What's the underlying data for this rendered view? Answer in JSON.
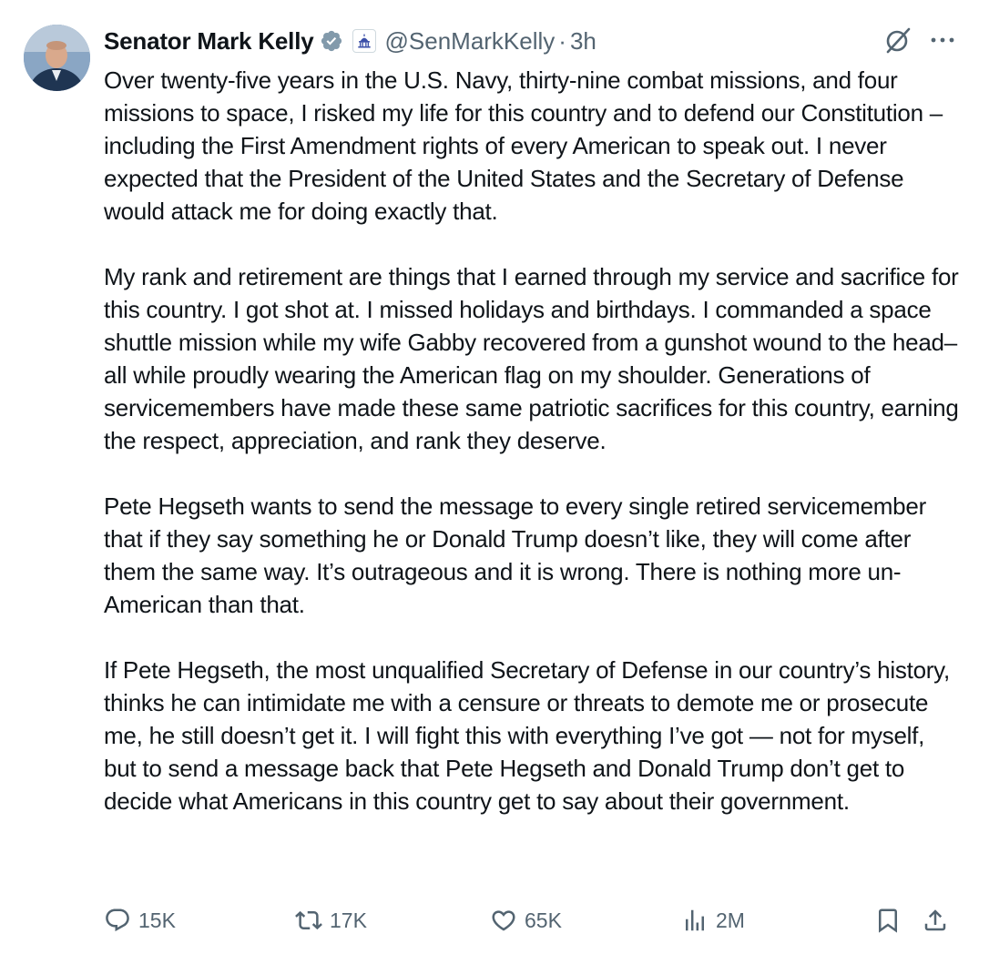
{
  "author": {
    "name": "Senator Mark Kelly",
    "handle": "@SenMarkKelly",
    "separator": "·",
    "time": "3h"
  },
  "icons": {
    "verified": "verified-badge-icon",
    "affiliation": "capitol-building-icon",
    "grok": "grok-icon",
    "more": "more-options-icon"
  },
  "paragraphs": [
    "Over twenty-five years in the U.S. Navy, thirty-nine combat missions, and four missions to space, I risked my life for this country and to defend our Constitution – including the First Amendment rights of every American to speak out. I never expected that the President of the United States and the Secretary of Defense would attack me for doing exactly that.",
    "My rank and retirement are things that I earned through my service and sacrifice for this country. I got shot at. I missed holidays and birthdays. I commanded a space shuttle mission while my wife Gabby recovered from a gunshot wound to the head– all while proudly wearing the American flag on my shoulder. Generations of servicemembers have made these same patriotic sacrifices for this country, earning the respect, appreciation, and rank they deserve.",
    "Pete Hegseth wants to send the message to every single retired servicemember that if they say something he or Donald Trump doesn’t like, they will come after them the same way. It’s outrageous and it is wrong. There is nothing more un-American than that.",
    "If Pete Hegseth, the most unqualified Secretary of Defense in our country’s history, thinks he can intimidate me with a censure or threats to demote me or prosecute me, he still doesn’t get it. I will fight this with everything I’ve got — not for myself, but to send a message back that Pete Hegseth and Donald Trump don’t get to decide what Americans in this country get to say about their government."
  ],
  "metrics": {
    "replies": "15K",
    "reposts": "17K",
    "likes": "65K",
    "views": "2M"
  },
  "colors": {
    "text": "#0f1419",
    "secondary": "#536471",
    "verified": "#829aab",
    "background": "#ffffff"
  }
}
